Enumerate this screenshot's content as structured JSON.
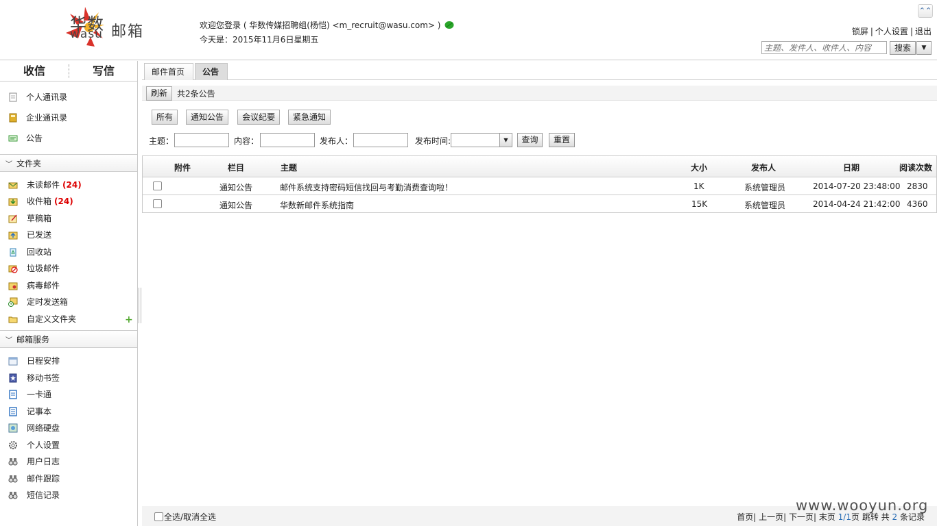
{
  "brand": {
    "logo_cn": "华数",
    "logo_en": "wasu",
    "logo_mail": "邮箱",
    "colors": {
      "accent_red": "#d9322a",
      "accent_yellow": "#f2b12b",
      "count_red": "#dd0000",
      "link_blue": "#2c6fb6"
    }
  },
  "header": {
    "welcome": "欢迎您登录 ( 华数传媒招聘组(杨恺)   <m_recruit@wasu.com> )",
    "today": "今天是：2015年11月6日星期五",
    "links": [
      "锁屏",
      "个人设置",
      "退出"
    ],
    "search_placeholder": "主题、发件人、收件人、内容",
    "search_label": "搜索",
    "dropdown_icon": "▼",
    "collapse_icon": "⌃"
  },
  "sidebar": {
    "receive": "收信",
    "write": "写信",
    "contacts": [
      {
        "label": "个人通讯录",
        "icon": "notepad-icon"
      },
      {
        "label": "企业通讯录",
        "icon": "address-book-icon"
      },
      {
        "label": "公告",
        "icon": "notice-icon"
      }
    ],
    "folders_title": "文件夹",
    "folders": [
      {
        "label": "未读邮件",
        "count": "(24)",
        "icon": "unread-mail-icon"
      },
      {
        "label": "收件箱",
        "count": "(24)",
        "icon": "inbox-icon"
      },
      {
        "label": "草稿箱",
        "count": "",
        "icon": "draft-icon"
      },
      {
        "label": "已发送",
        "count": "",
        "icon": "sent-icon"
      },
      {
        "label": "回收站",
        "count": "",
        "icon": "recycle-icon"
      },
      {
        "label": "垃圾邮件",
        "count": "",
        "icon": "spam-icon"
      },
      {
        "label": "病毒邮件",
        "count": "",
        "icon": "virus-icon"
      },
      {
        "label": "定时发送箱",
        "count": "",
        "icon": "scheduled-icon"
      },
      {
        "label": "自定义文件夹",
        "count": "",
        "icon": "folder-icon"
      }
    ],
    "add_icon": "+",
    "services_title": "邮箱服务",
    "services": [
      {
        "label": "日程安排",
        "icon": "calendar-icon"
      },
      {
        "label": "移动书签",
        "icon": "bookmark-icon"
      },
      {
        "label": "一卡通",
        "icon": "card-icon"
      },
      {
        "label": "记事本",
        "icon": "notebook-icon"
      },
      {
        "label": "网络硬盘",
        "icon": "netdisk-icon"
      },
      {
        "label": "个人设置",
        "icon": "gear-icon"
      },
      {
        "label": "用户日志",
        "icon": "binoculars-icon"
      },
      {
        "label": "邮件跟踪",
        "icon": "binoculars-icon"
      },
      {
        "label": "短信记录",
        "icon": "binoculars-icon"
      }
    ]
  },
  "main": {
    "tabs": [
      "邮件首页",
      "公告"
    ],
    "refresh": "刷新",
    "total": "共2条公告",
    "filters": [
      "所有",
      "通知公告",
      "会议纪要",
      "紧急通知"
    ],
    "query": {
      "subject_label": "主题：",
      "content_label": "内容：",
      "publisher_label": "发布人：",
      "time_label": "发布时间:",
      "search": "查询",
      "reset": "重置"
    },
    "columns": [
      "附件",
      "栏目",
      "主题",
      "大小",
      "发布人",
      "日期",
      "阅读次数"
    ],
    "rows": [
      {
        "category": "通知公告",
        "subject": "邮件系统支持密码短信找回与考勤消费查询啦！",
        "size": "1K",
        "publisher": "系统管理员",
        "date": "2014-07-20 23:48:00",
        "reads": "2830"
      },
      {
        "category": "通知公告",
        "subject": "华数新邮件系统指南",
        "size": "15K",
        "publisher": "系统管理员",
        "date": "2014-04-24 21:42:00",
        "reads": "4360"
      }
    ],
    "select_all": "全选/取消全选",
    "pager": {
      "first": "首页",
      "prev": "上一页",
      "next": "下一页",
      "last": "末页",
      "page": "1/1",
      "page_suffix": "页",
      "jump": "跳转",
      "total_prefix": "共",
      "total_count": "2",
      "total_suffix": "条记录"
    }
  },
  "watermark": "www.wooyun.org"
}
